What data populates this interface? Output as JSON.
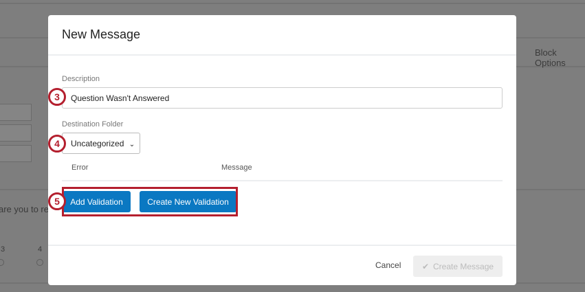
{
  "background": {
    "block_options": "Block Options",
    "question_fragment": "are you to re",
    "scale_labels": [
      "3",
      "4"
    ]
  },
  "modal": {
    "title": "New Message",
    "description_label": "Description",
    "description_value": "Question Wasn't Answered",
    "folder_label": "Destination Folder",
    "folder_value": "Uncategorized",
    "table_headers": [
      "Error",
      "Message"
    ],
    "add_validation": "Add Validation",
    "create_new_validation": "Create New Validation",
    "cancel": "Cancel",
    "create_message": "Create Message"
  },
  "annotations": [
    "3",
    "4",
    "5"
  ],
  "colors": {
    "accent": "#0a78c2",
    "annotation": "#b41f2e"
  }
}
